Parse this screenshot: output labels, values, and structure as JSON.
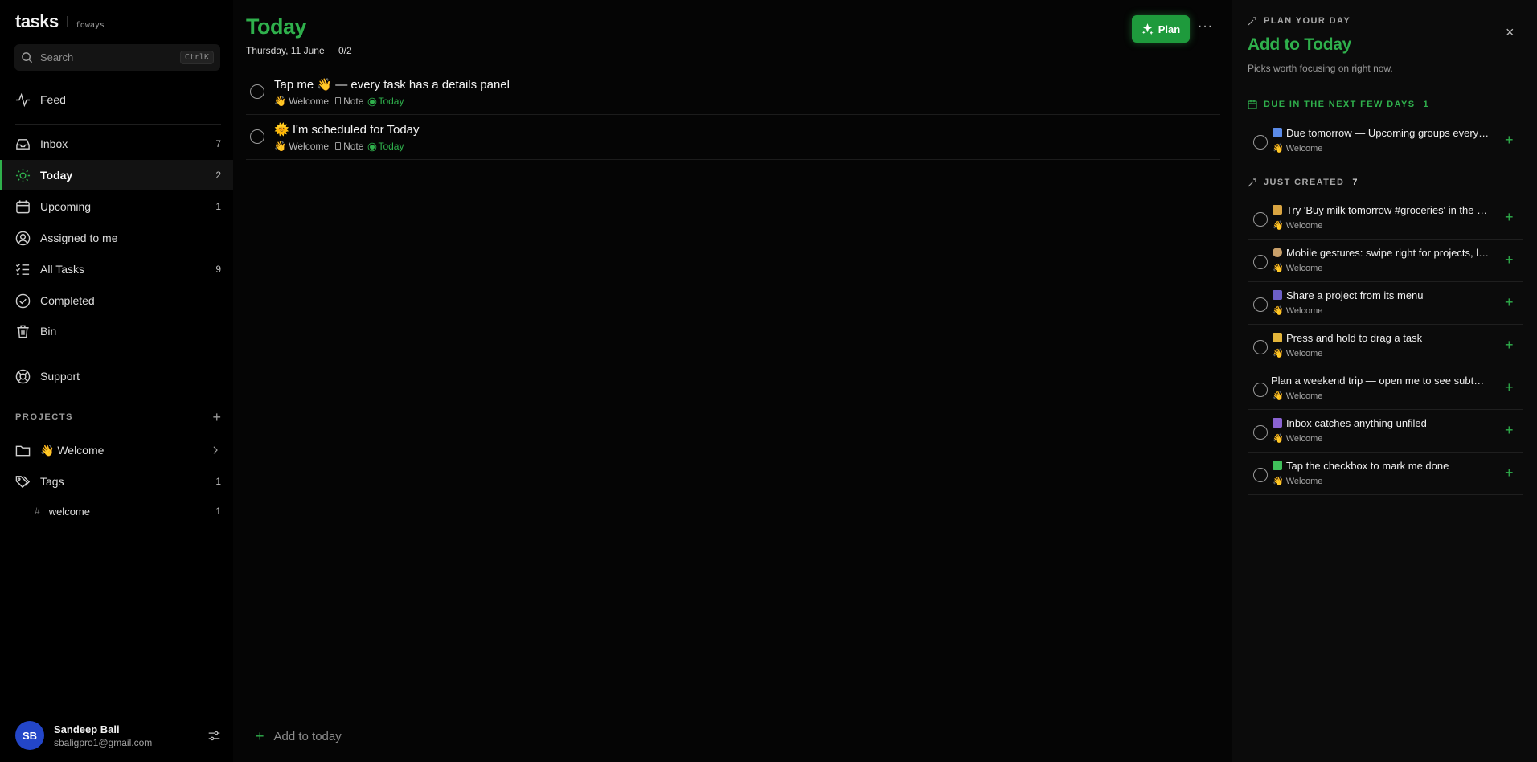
{
  "app": {
    "title": "tasks",
    "subtitle": "foways"
  },
  "search": {
    "placeholder": "Search",
    "shortcut": "CtrlK"
  },
  "nav": [
    {
      "label": "Feed",
      "count": "",
      "icon": "activity-icon"
    },
    {
      "label": "Inbox",
      "count": "7",
      "icon": "inbox-icon"
    },
    {
      "label": "Today",
      "count": "2",
      "icon": "sun-icon",
      "active": true
    },
    {
      "label": "Upcoming",
      "count": "1",
      "icon": "calendar-icon"
    },
    {
      "label": "Assigned to me",
      "count": "",
      "icon": "user-circle-icon"
    },
    {
      "label": "All Tasks",
      "count": "9",
      "icon": "list-check-icon"
    },
    {
      "label": "Completed",
      "count": "",
      "icon": "check-circle-icon"
    },
    {
      "label": "Bin",
      "count": "",
      "icon": "trash-icon"
    },
    {
      "label": "Support",
      "count": "",
      "icon": "lifebuoy-icon"
    }
  ],
  "projects": {
    "label": "PROJECTS",
    "add": "+",
    "items": [
      {
        "label": "👋 Welcome",
        "icon": "folder-icon"
      }
    ]
  },
  "tags": {
    "label": "Tags",
    "count": "1",
    "items": [
      {
        "hash": "#",
        "label": "welcome",
        "count": "1"
      }
    ]
  },
  "user": {
    "initials": "SB",
    "name": "Sandeep Bali",
    "email": "sbaligpro1@gmail.com"
  },
  "main": {
    "title": "Today",
    "date": "Thursday, 11 June",
    "progress": "0/2",
    "plan_label": "Plan",
    "more": "···",
    "add_label": "Add to today",
    "tasks": [
      {
        "title": "Tap me 👋 — every task has a details panel",
        "project": "👋 Welcome",
        "note": "Note",
        "due": "Today"
      },
      {
        "title": "🌞 I'm scheduled for Today",
        "project": "👋 Welcome",
        "note": "Note",
        "due": "Today"
      }
    ]
  },
  "panel": {
    "kicker": "PLAN YOUR DAY",
    "title": "Add to Today",
    "description": "Picks worth focusing on right now.",
    "close": "×",
    "sections": [
      {
        "label": "DUE IN THE NEXT FEW DAYS",
        "count": "1",
        "items": [
          {
            "title": "Due tomorrow — Upcoming groups everything by date",
            "project": "👋 Welcome",
            "emoji_color": "#5b8be8"
          }
        ]
      },
      {
        "label": "JUST CREATED",
        "count": "7",
        "items": [
          {
            "title": "Try 'Buy milk tomorrow #groceries' in the quick add",
            "project": "👋 Welcome",
            "emoji_color": "#d9a441"
          },
          {
            "title": "Mobile gestures: swipe right for projects, left for menu",
            "project": "👋 Welcome",
            "emoji_color": "#c9a06a"
          },
          {
            "title": "Share a project from its menu",
            "project": "👋 Welcome",
            "emoji_color": "#6c5fc7"
          },
          {
            "title": "Press and hold to drag a task",
            "project": "👋 Welcome",
            "emoji_color": "#e3b53a"
          },
          {
            "title": "Plan a weekend trip — open me to see subtasks",
            "project": "👋 Welcome",
            "emoji_color": ""
          },
          {
            "title": "Inbox catches anything unfiled",
            "project": "👋 Welcome",
            "emoji_color": "#8a63d2"
          },
          {
            "title": "Tap the checkbox to mark me done",
            "project": "👋 Welcome",
            "emoji_color": "#3fbf5a"
          }
        ]
      }
    ]
  },
  "colors": {
    "accent": "#2fb04c",
    "avatar": "#2346c8"
  }
}
